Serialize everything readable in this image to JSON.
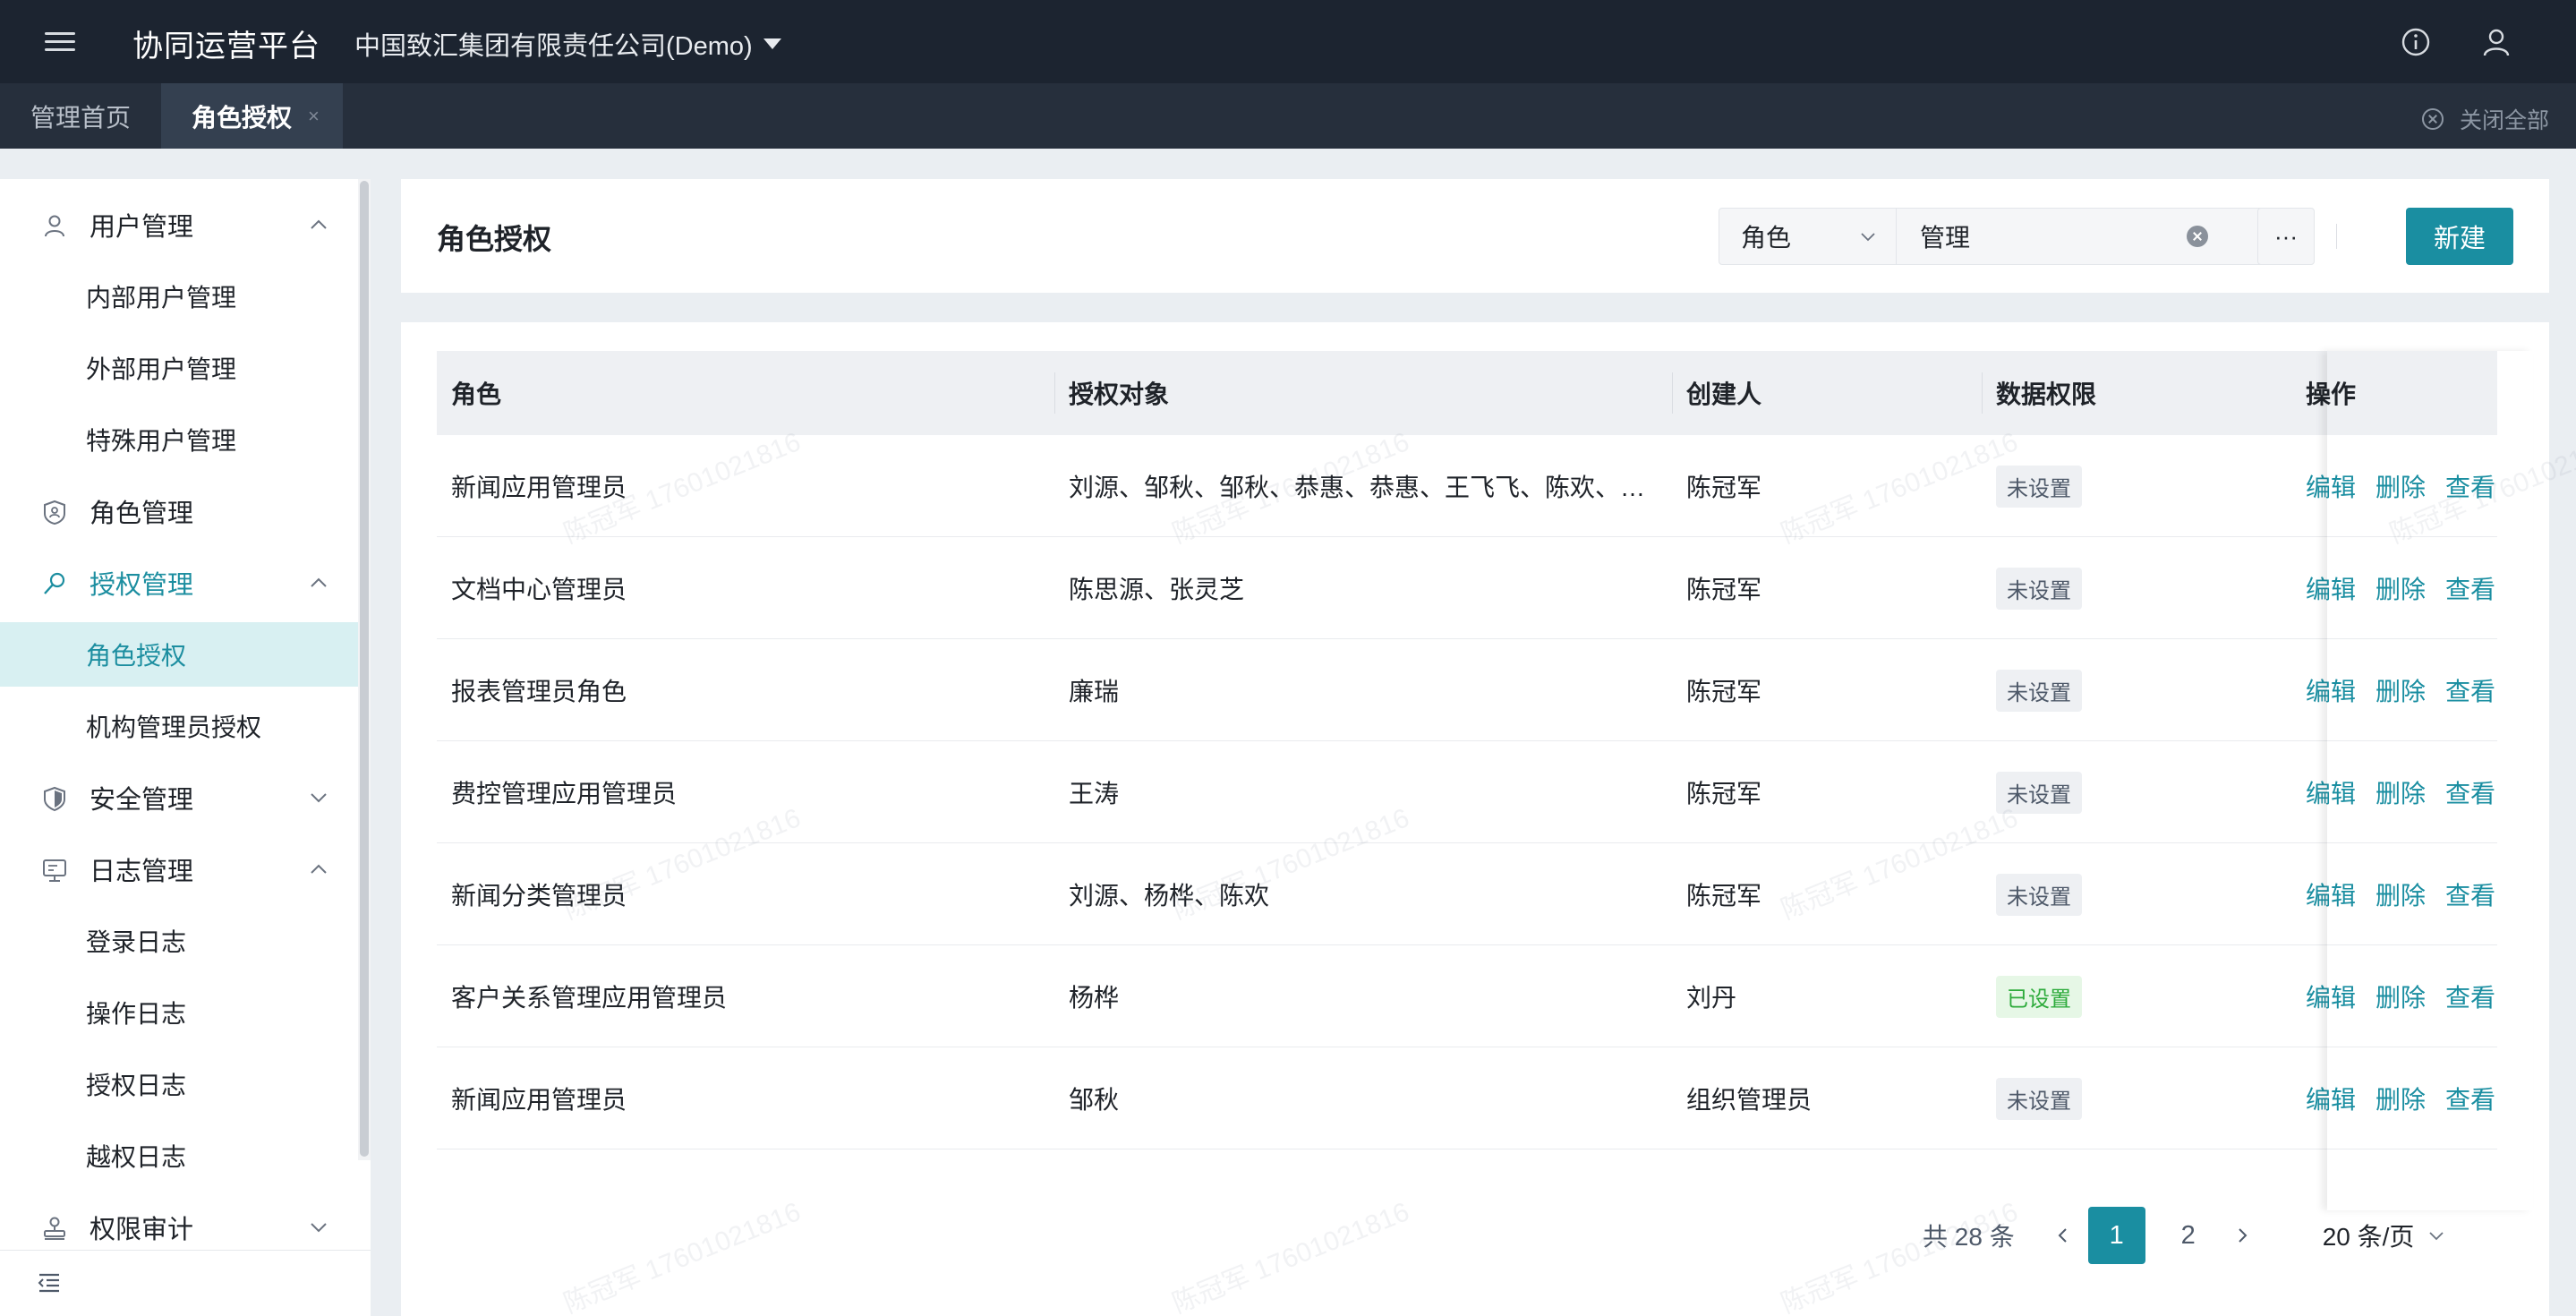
{
  "header": {
    "app_title": "协同运营平台",
    "org_name": "中国致汇集团有限责任公司(Demo)"
  },
  "tabs": {
    "items": [
      {
        "label": "管理首页"
      },
      {
        "label": "角色授权",
        "close": "×"
      }
    ],
    "close_all": "关闭全部"
  },
  "sidebar": {
    "groups": [
      {
        "label": "用户管理",
        "icon": "user-icon",
        "expanded": true
      },
      {
        "label": "角色管理",
        "icon": "role-badge-icon"
      },
      {
        "label": "授权管理",
        "icon": "key-icon",
        "expanded": true,
        "active": true
      },
      {
        "label": "安全管理",
        "icon": "shield-icon",
        "expanded": false
      },
      {
        "label": "日志管理",
        "icon": "monitor-icon",
        "expanded": true
      },
      {
        "label": "权限审计",
        "icon": "stamp-icon",
        "expanded": false
      }
    ],
    "items": {
      "internal_user": "内部用户管理",
      "external_user": "外部用户管理",
      "special_user": "特殊用户管理",
      "role_auth": "角色授权",
      "org_admin_auth": "机构管理员授权",
      "login_log": "登录日志",
      "operation_log": "操作日志",
      "auth_log": "授权日志",
      "overreach_log": "越权日志"
    }
  },
  "page": {
    "title": "角色授权",
    "search": {
      "field": "角色",
      "value": "管理"
    },
    "more_label": "···",
    "new_button": "新建"
  },
  "table": {
    "columns": [
      "角色",
      "授权对象",
      "创建人",
      "数据权限",
      "操作"
    ],
    "rows": [
      {
        "role": "新闻应用管理员",
        "targets": "刘源、邹秋、邹秋、恭惠、恭惠、王飞飞、陈欢、…",
        "creator": "陈冠军",
        "data_perm": "未设置",
        "set": false
      },
      {
        "role": "文档中心管理员",
        "targets": "陈思源、张灵芝",
        "creator": "陈冠军",
        "data_perm": "未设置",
        "set": false
      },
      {
        "role": "报表管理员角色",
        "targets": "廉瑞",
        "creator": "陈冠军",
        "data_perm": "未设置",
        "set": false
      },
      {
        "role": "费控管理应用管理员",
        "targets": "王涛",
        "creator": "陈冠军",
        "data_perm": "未设置",
        "set": false
      },
      {
        "role": "新闻分类管理员",
        "targets": "刘源、杨桦、陈欢",
        "creator": "陈冠军",
        "data_perm": "未设置",
        "set": false
      },
      {
        "role": "客户关系管理应用管理员",
        "targets": "杨桦",
        "creator": "刘丹",
        "data_perm": "已设置",
        "set": true
      },
      {
        "role": "新闻应用管理员",
        "targets": "邹秋",
        "creator": "组织管理员",
        "data_perm": "未设置",
        "set": false
      }
    ],
    "actions": {
      "edit": "编辑",
      "delete": "删除",
      "view": "查看."
    }
  },
  "pagination": {
    "total": "共 28 条",
    "pages": [
      "1",
      "2"
    ],
    "current": "1",
    "page_size": "20 条/页"
  },
  "watermark": "陈冠军 17601021816",
  "colors": {
    "accent": "#1a8ea1",
    "topbar": "#1c2430",
    "tabbar": "#262f3c",
    "selected_bg": "#d8f0f2",
    "set_badge": "#2eab3c"
  }
}
